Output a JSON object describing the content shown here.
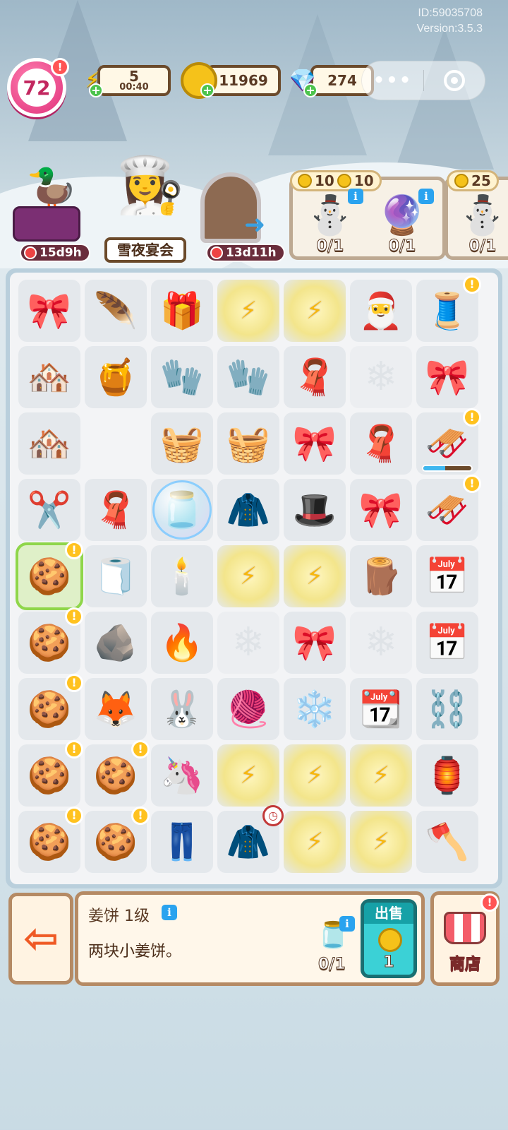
{
  "header": {
    "id_text": "ID:59035708",
    "version_text": "Version:3.5.3"
  },
  "player": {
    "level": "72"
  },
  "resources": {
    "energy": {
      "value": "5",
      "timer": "00:40",
      "icon": "lightning-icon"
    },
    "coins": {
      "value": "11969",
      "icon": "coin-icon"
    },
    "gems": {
      "value": "274",
      "icon": "gem-icon"
    }
  },
  "capsule": {
    "more": "•••"
  },
  "events": {
    "goose_timer": "15d9h",
    "party_label": "雪夜宴会",
    "door_timer": "13d11h"
  },
  "orders": [
    {
      "cost_a": "10",
      "cost_b": "10",
      "slots": [
        {
          "item": "snowman",
          "count": "0/1"
        },
        {
          "item": "snow-globe",
          "count": "0/1"
        }
      ]
    },
    {
      "cost_a": "25",
      "slots": [
        {
          "item": "snowman",
          "count": "0/1"
        }
      ]
    }
  ],
  "board": {
    "rows": [
      [
        "🎀",
        "🪶",
        "🎁",
        "⚡",
        "⚡",
        "🎅",
        "🧵"
      ],
      [
        "🏘️",
        "🍯",
        "🧤",
        "🧤",
        "🧣",
        "",
        "🎀"
      ],
      [
        "🏘️",
        "",
        "🧺",
        "🧺",
        "🎀",
        "🧣",
        "🛷"
      ],
      [
        "✂️",
        "🧣",
        "🫙",
        "🧥",
        "🎩",
        "🎀",
        "🛷"
      ],
      [
        "🍪",
        "🧻",
        "🕯️",
        "⚡",
        "⚡",
        "🪵",
        "📅"
      ],
      [
        "🍪",
        "🪨",
        "🔥",
        "",
        "🎀",
        "",
        "📅"
      ],
      [
        "🍪",
        "🦊",
        "🐰",
        "🧶",
        "❄️",
        "📆",
        "⛓️"
      ],
      [
        "🍪",
        "🍪",
        "🦄",
        "⚡",
        "⚡",
        "⚡",
        "🏮"
      ],
      [
        "🍪",
        "🍪",
        "👖",
        "🧥",
        "⚡",
        "⚡",
        "🪓"
      ]
    ]
  },
  "selected_item": {
    "name": "姜饼 1级",
    "description": "两块小姜饼。",
    "required_count": "0/1",
    "sell_label": "出售",
    "sell_price": "1"
  },
  "shop": {
    "label": "商店"
  },
  "colors": {
    "accent_level": "#e0307a",
    "sell_button": "#3bd1d6",
    "selected_cell": "#8fd64a"
  }
}
